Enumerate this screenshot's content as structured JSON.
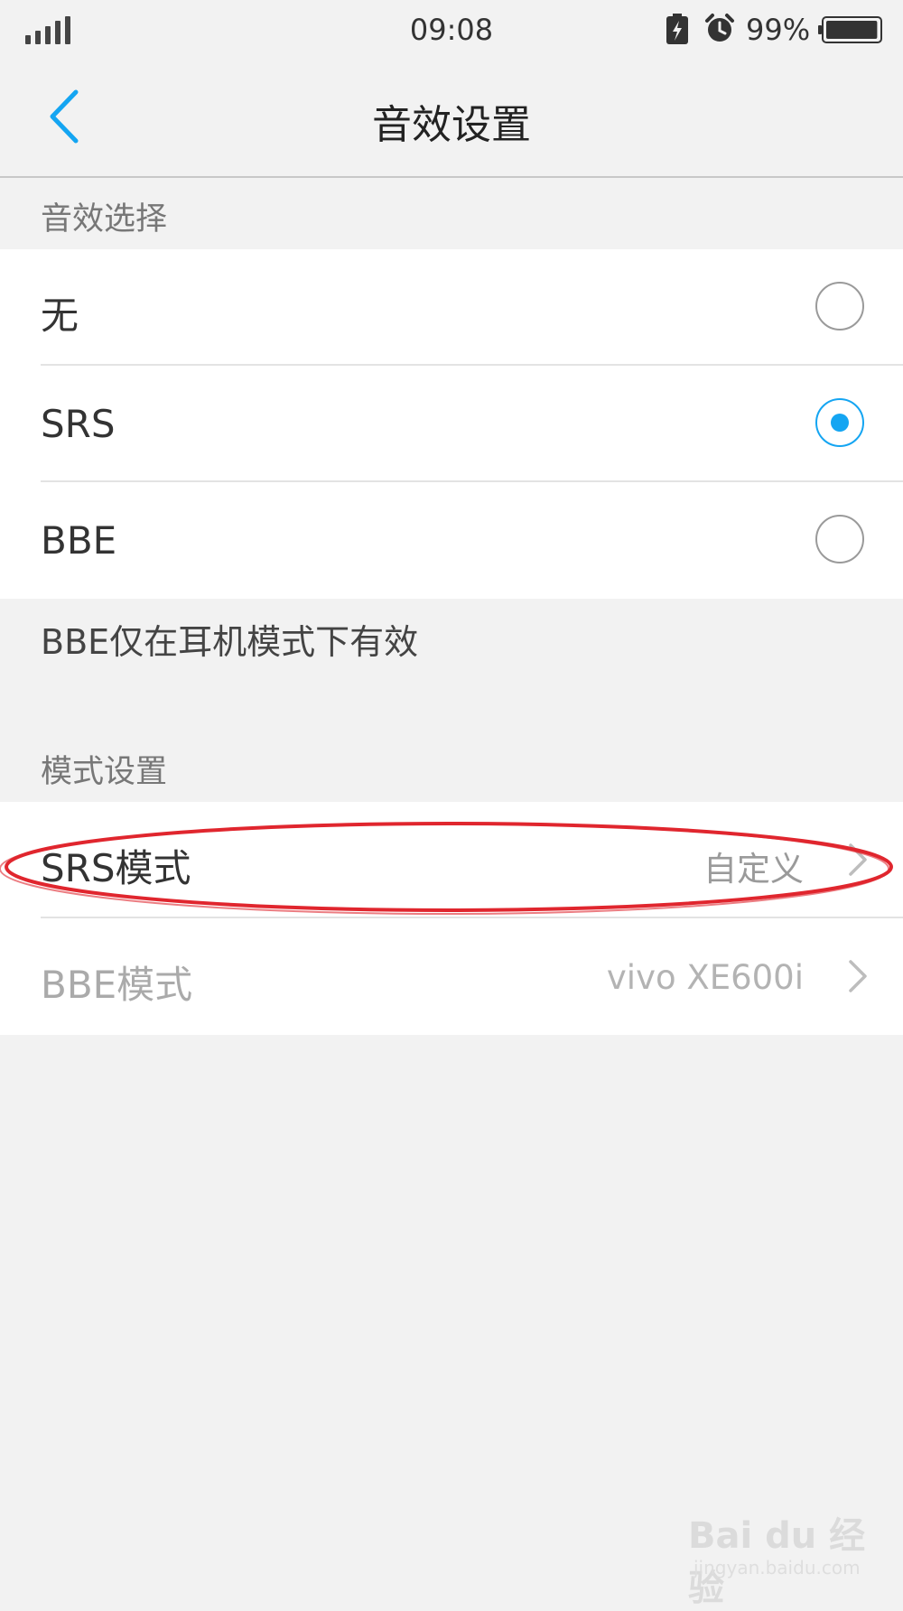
{
  "status_bar": {
    "time": "09:08",
    "battery_percent": "99%",
    "battery_level": 0.99,
    "icons": [
      "signal-icon",
      "battery-charge-icon",
      "alarm-icon",
      "battery-icon"
    ]
  },
  "nav": {
    "title": "音效设置",
    "back_icon": "back-icon"
  },
  "sound_effect": {
    "header": "音效选择",
    "options": [
      {
        "label": "无",
        "selected": false
      },
      {
        "label": "SRS",
        "selected": true
      },
      {
        "label": "BBE",
        "selected": false
      }
    ],
    "note": "BBE仅在耳机模式下有效"
  },
  "mode_settings": {
    "header": "模式设置",
    "items": [
      {
        "label": "SRS模式",
        "value": "自定义",
        "enabled": true
      },
      {
        "label": "BBE模式",
        "value": "vivo XE600i",
        "enabled": false
      }
    ]
  },
  "watermark": {
    "logo": "Bai du 经验",
    "url": "jingyan.baidu.com"
  },
  "colors": {
    "accent": "#14a5f2",
    "annotation": "#e0262e",
    "background": "#f2f2f2"
  }
}
